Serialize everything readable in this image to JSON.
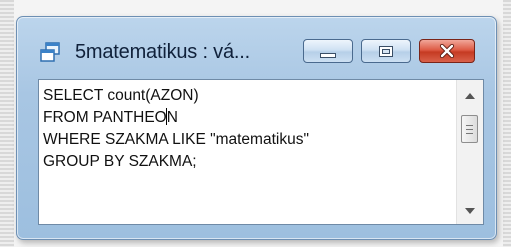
{
  "window": {
    "title": "5matematikus : vá...",
    "buttons": {
      "minimize": "minimize",
      "maximize": "maximize",
      "close": "close"
    }
  },
  "editor": {
    "lines": [
      "SELECT count(AZON)",
      "FROM PANTHEON",
      "WHERE SZAKMA LIKE \"matematikus\"",
      "GROUP BY SZAKMA;"
    ],
    "line2_before_caret": "FROM PANTHEO",
    "line2_after_caret": "N"
  },
  "colors": {
    "title_text": "#10213a",
    "close_button": "#c53a22",
    "frame": "#a8c6e3"
  }
}
